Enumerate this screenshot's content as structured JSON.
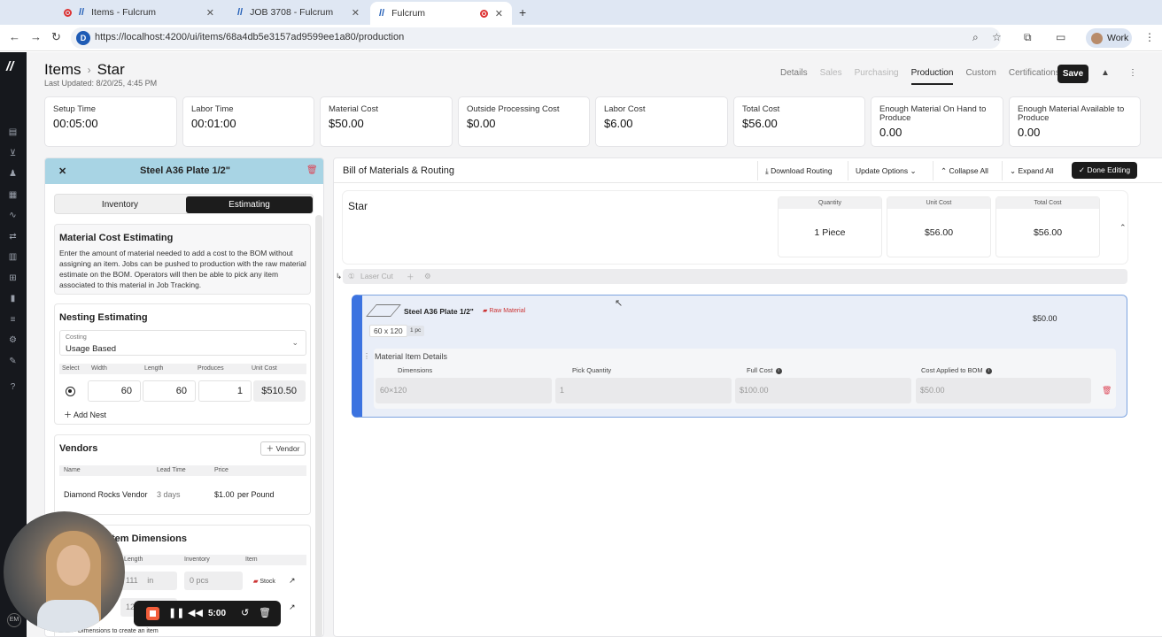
{
  "browser": {
    "tabs": [
      {
        "title": "Items - Fulcrum"
      },
      {
        "title": "JOB 3708 - Fulcrum"
      },
      {
        "title": "Fulcrum"
      }
    ],
    "url": "https://localhost:4200/ui/items/68a4db5e3157ad9599ee1a80/production",
    "profile": "Work"
  },
  "header": {
    "breadcrumb_root": "Items",
    "breadcrumb_current": "Star",
    "last_updated": "Last Updated: 8/20/25, 4:45 PM",
    "tabs": [
      "Details",
      "Sales",
      "Purchasing",
      "Production",
      "Custom",
      "Certifications"
    ],
    "active_tab": "Production",
    "save_label": "Save"
  },
  "stats": [
    {
      "label": "Setup Time",
      "value": "00:05:00"
    },
    {
      "label": "Labor Time",
      "value": "00:01:00"
    },
    {
      "label": "Material Cost",
      "value": "$50.00"
    },
    {
      "label": "Outside Processing Cost",
      "value": "$0.00"
    },
    {
      "label": "Labor Cost",
      "value": "$6.00"
    },
    {
      "label": "Total Cost",
      "value": "$56.00"
    },
    {
      "label": "Enough Material On Hand to Produce",
      "value": "0.00"
    },
    {
      "label": "Enough Material Available to Produce",
      "value": "0.00"
    }
  ],
  "left_panel": {
    "title": "Steel A36 Plate 1/2\"",
    "seg_inventory": "Inventory",
    "seg_estimating": "Estimating",
    "mce_title": "Material Cost Estimating",
    "mce_text": "Enter the amount of material needed to add a cost to the BOM without assigning an item. Jobs can be pushed to production with the raw material estimate on the BOM. Operators will then be able to pick any item associated to this material in Job Tracking.",
    "nest_title": "Nesting Estimating",
    "costing_label": "Costing",
    "costing_value": "Usage Based",
    "nest_cols": [
      "Select",
      "Width",
      "Length",
      "Produces",
      "Unit Cost"
    ],
    "nest_row": {
      "width": "60",
      "length": "60",
      "produces": "1",
      "unit_cost": "$510.50"
    },
    "add_nest": "Add Nest",
    "vendors_title": "Vendors",
    "vendor_btn": "Vendor",
    "vendor_cols": [
      "Name",
      "Lead Time",
      "Price"
    ],
    "vendor_row": {
      "name": "Diamond Rocks Vendor",
      "lead": "3 days",
      "price": "$1.00",
      "unit": "per Pound"
    },
    "dims_title": "tem Dimensions",
    "dims_cols": [
      "Length",
      "Inventory",
      "Item"
    ],
    "dims_row1": {
      "length": "111",
      "unit": "in",
      "inventory": "0 pcs",
      "item": "Stock"
    },
    "dims_row2_len": "12",
    "dims_hint": "Dimensions to create an item"
  },
  "recorder": {
    "time": "5:00"
  },
  "right_panel": {
    "title": "Bill of Materials & Routing",
    "download": "Download Routing",
    "update": "Update Options",
    "collapse": "Collapse All",
    "expand": "Expand All",
    "done": "Done Editing",
    "item_name": "Star",
    "cols": [
      {
        "head": "Quantity",
        "value": "1 Piece"
      },
      {
        "head": "Unit Cost",
        "value": "$56.00"
      },
      {
        "head": "Total Cost",
        "value": "$56.00"
      }
    ],
    "operation": "Laser Cut",
    "material": {
      "name": "Steel A36 Plate 1/2\"",
      "badge": "Raw Material",
      "price": "$50.00",
      "size": "60 x 120",
      "pcs": "1 pc",
      "details_title": "Material Item Details",
      "detail_cols": [
        "Dimensions",
        "Pick Quantity",
        "Full Cost",
        "Cost Applied to BOM"
      ],
      "detail_vals": [
        "60×120",
        "1",
        "$100.00",
        "$50.00"
      ]
    }
  },
  "rail": {
    "avatar": "EM"
  }
}
